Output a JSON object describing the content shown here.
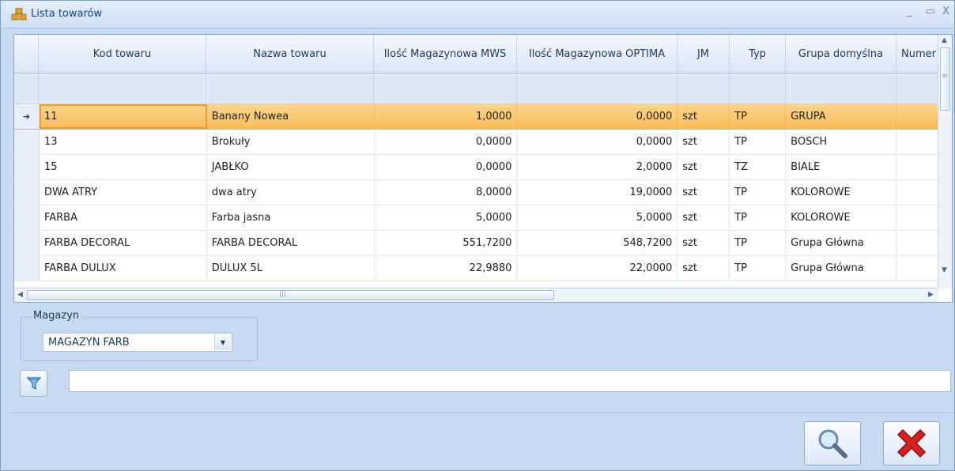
{
  "window": {
    "title": "Lista towarów",
    "controls": {
      "minimize": "_",
      "maximize": "▭",
      "close": "X"
    }
  },
  "grid": {
    "columns": [
      "",
      "Kod towaru",
      "Nazwa towaru",
      "Ilość Magazynowa MWS",
      "Ilość Magazynowa OPTIMA",
      "JM",
      "Typ",
      "Grupa domyślna",
      "Numer"
    ],
    "selected_row_indicator": "➜",
    "rows": [
      {
        "kod": "11",
        "nazwa": "Banany Nowea",
        "mws": "1,0000",
        "optima": "0,0000",
        "jm": "szt",
        "typ": "TP",
        "grupa": "GRUPA",
        "numer": ""
      },
      {
        "kod": "13",
        "nazwa": "Brokuły",
        "mws": "0,0000",
        "optima": "0,0000",
        "jm": "szt",
        "typ": "TP",
        "grupa": "BOSCH",
        "numer": ""
      },
      {
        "kod": "15",
        "nazwa": "JABŁKO",
        "mws": "0,0000",
        "optima": "2,0000",
        "jm": "szt",
        "typ": "TZ",
        "grupa": "BIALE",
        "numer": ""
      },
      {
        "kod": "DWA ATRY",
        "nazwa": "dwa atry",
        "mws": "8,0000",
        "optima": "19,0000",
        "jm": "szt",
        "typ": "TP",
        "grupa": "KOLOROWE",
        "numer": ""
      },
      {
        "kod": "FARBA",
        "nazwa": "Farba jasna",
        "mws": "5,0000",
        "optima": "5,0000",
        "jm": "szt",
        "typ": "TP",
        "grupa": "KOLOROWE",
        "numer": ""
      },
      {
        "kod": "FARBA DECORAL",
        "nazwa": "FARBA DECORAL",
        "mws": "551,7200",
        "optima": "548,7200",
        "jm": "szt",
        "typ": "TP",
        "grupa": "Grupa Główna",
        "numer": ""
      },
      {
        "kod": "FARBA DULUX",
        "nazwa": "DULUX 5L",
        "mws": "22,9880",
        "optima": "22,0000",
        "jm": "szt",
        "typ": "TP",
        "grupa": "Grupa Główna",
        "numer": ""
      }
    ],
    "scroll_icons": {
      "up": "▲",
      "down": "▼",
      "left": "◀",
      "right": "▶",
      "grip_h": "|||",
      "grip_v": "≡"
    }
  },
  "magazyn": {
    "label": "Magazyn",
    "selected": "MAGAZYN FARB",
    "dropdown_icon": "▼"
  },
  "filter": {
    "button_icon": "funnel-icon",
    "input_value": ""
  },
  "actions": {
    "search_icon": "magnifier-icon",
    "cancel_icon": "red-x-icon"
  },
  "colors": {
    "selected_row": "#f8bd5a",
    "background": "#c7daf2",
    "cancel": "#d42020"
  }
}
